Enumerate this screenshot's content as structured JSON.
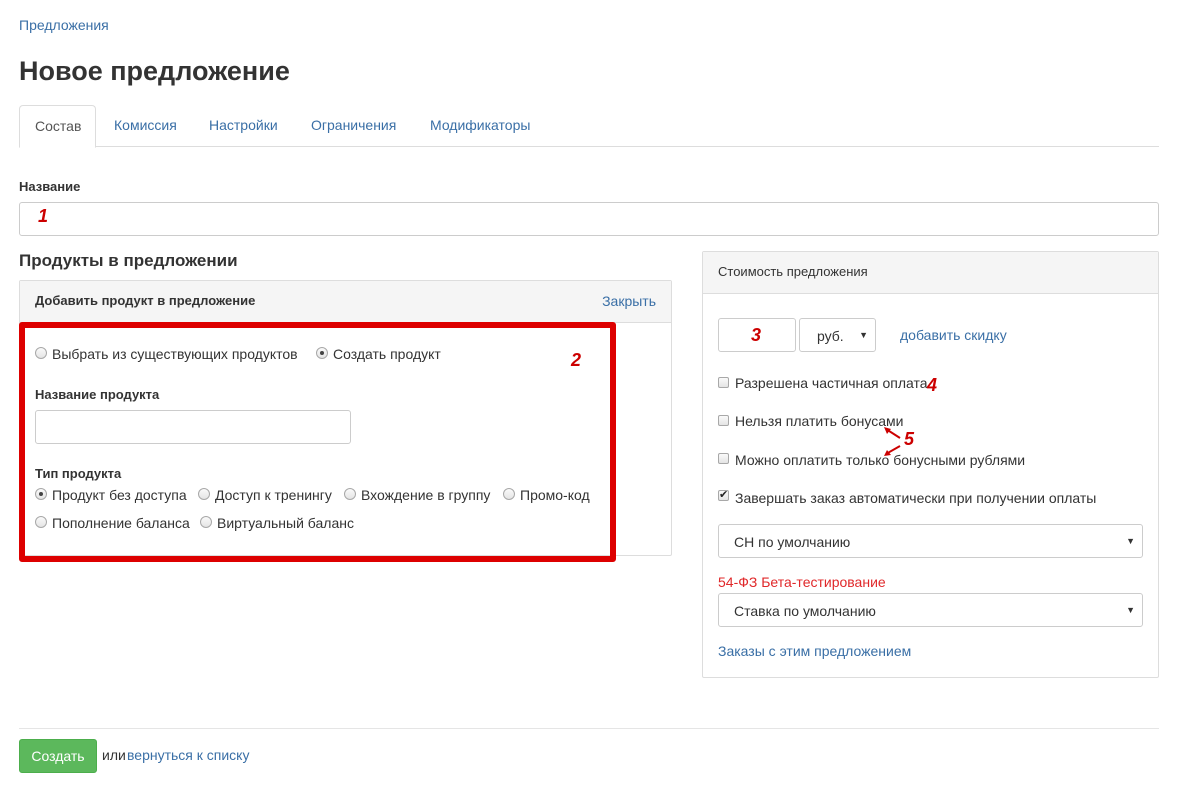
{
  "breadcrumb": "Предложения",
  "page_title": "Новое предложение",
  "tabs": [
    {
      "label": "Состав"
    },
    {
      "label": "Комиссия"
    },
    {
      "label": "Настройки"
    },
    {
      "label": "Ограничения"
    },
    {
      "label": "Модификаторы"
    }
  ],
  "name_field": {
    "label": "Название",
    "value": ""
  },
  "products": {
    "section_title": "Продукты в предложении",
    "panel_title": "Добавить продукт в предложение",
    "close_link": "Закрыть",
    "source_options": [
      {
        "label": "Выбрать из существующих продуктов",
        "checked": false
      },
      {
        "label": "Создать продукт",
        "checked": true
      }
    ],
    "product_name_label": "Название продукта",
    "product_name_value": "",
    "type_label": "Тип продукта",
    "type_options": [
      {
        "label": "Продукт без доступа",
        "checked": true
      },
      {
        "label": "Доступ к тренингу",
        "checked": false
      },
      {
        "label": "Вхождение в группу",
        "checked": false
      },
      {
        "label": "Промо-код",
        "checked": false
      },
      {
        "label": "Пополнение баланса",
        "checked": false
      },
      {
        "label": "Виртуальный баланс",
        "checked": false
      }
    ]
  },
  "cost": {
    "panel_title": "Стоимость предложения",
    "price_value": "",
    "currency": "руб.",
    "add_discount": "добавить скидку",
    "checkboxes": [
      {
        "label": "Разрешена частичная оплата",
        "checked": false
      },
      {
        "label": "Нельзя платить бонусами",
        "checked": false
      },
      {
        "label": "Можно оплатить только бонусными рублями",
        "checked": false
      },
      {
        "label": "Завершать заказ автоматически при получении оплаты",
        "checked": true
      }
    ],
    "tax_system": "СН по умолчанию",
    "beta_label": "54-ФЗ Бета-тестирование",
    "vat_rate": "Ставка по умолчанию",
    "orders_link": "Заказы с этим предложением"
  },
  "annotations": [
    "1",
    "2",
    "3",
    "4",
    "5"
  ],
  "footer": {
    "create_button": "Создать",
    "or_text": "или",
    "back_link": "вернуться к списку"
  },
  "colors": {
    "link": "#3a6fa6",
    "annotation": "#cc0000",
    "create_button": "#5cb85c",
    "beta_label": "#e0282a"
  }
}
